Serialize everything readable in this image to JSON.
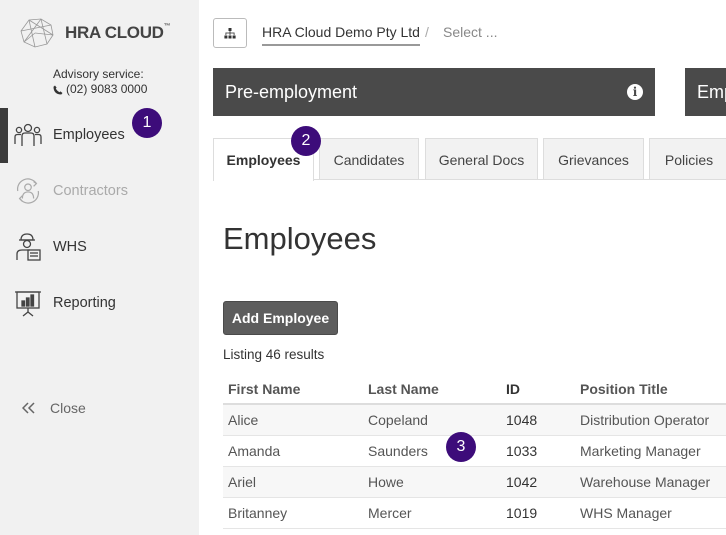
{
  "app": {
    "logo_text": "HRA CLOUD",
    "logo_tm": "™",
    "advisory_label": "Advisory service:",
    "advisory_phone": "(02) 9083 0000"
  },
  "sidebar": {
    "items": [
      {
        "label": "Employees",
        "icon": "employees-icon",
        "active": true
      },
      {
        "label": "Contractors",
        "icon": "contractors-icon",
        "disabled": true
      },
      {
        "label": "WHS",
        "icon": "whs-icon"
      },
      {
        "label": "Reporting",
        "icon": "reporting-icon"
      }
    ],
    "close_label": "Close"
  },
  "breadcrumb": {
    "company": "HRA Cloud Demo Pty Ltd",
    "separator": "/",
    "select_placeholder": "Select ..."
  },
  "banners": {
    "primary_title": "Pre-employment",
    "secondary_title": "Emp"
  },
  "tabs": [
    {
      "label": "Employees",
      "active": true
    },
    {
      "label": "Candidates"
    },
    {
      "label": "General Docs"
    },
    {
      "label": "Grievances"
    },
    {
      "label": "Policies"
    }
  ],
  "page_title": "Employees",
  "add_button_label": "Add Employee",
  "listing_text": "Listing 46 results",
  "table": {
    "headers": [
      "First Name",
      "Last Name",
      "ID",
      "Position Title"
    ],
    "rows": [
      [
        "Alice",
        "Copeland",
        "1048",
        "Distribution Operator"
      ],
      [
        "Amanda",
        "Saunders",
        "1033",
        "Marketing Manager"
      ],
      [
        "Ariel",
        "Howe",
        "1042",
        "Warehouse Manager"
      ],
      [
        "Britanney",
        "Mercer",
        "1019",
        "WHS Manager"
      ]
    ]
  },
  "annotations": [
    "1",
    "2",
    "3"
  ],
  "colors": {
    "sidebar_bg": "#f1f1f1",
    "banner_bg": "#4a4a4a",
    "badge": "#3d0c7a",
    "button_bg": "#5d5d5d"
  }
}
